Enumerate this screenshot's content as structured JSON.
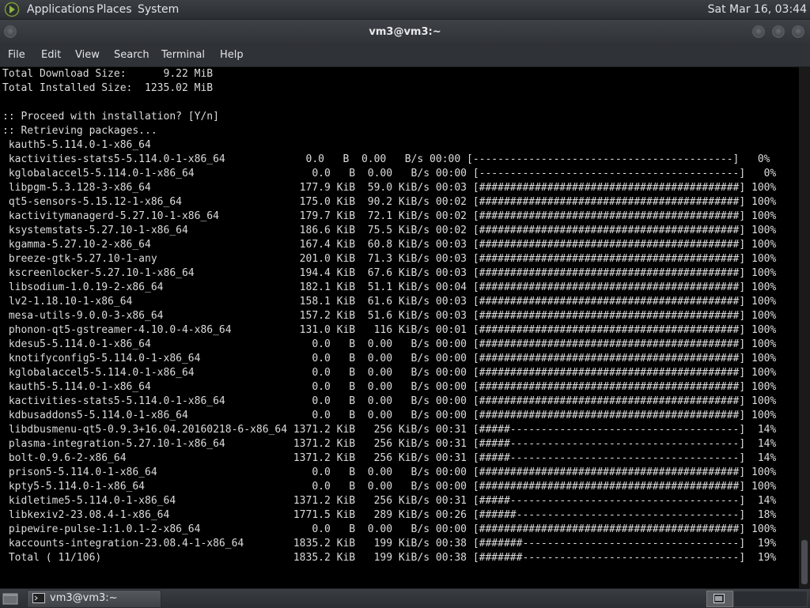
{
  "top_panel": {
    "menus": [
      "Applications",
      "Places",
      "System"
    ],
    "clock": "Sat Mar 16, 03:44"
  },
  "window": {
    "title": "vm3@vm3:~",
    "menu": [
      "File",
      "Edit",
      "View",
      "Search",
      "Terminal",
      "Help"
    ]
  },
  "terminal": {
    "lines": [
      "Total Download Size:      9.22 MiB",
      "Total Installed Size:  1235.02 MiB",
      "",
      ":: Proceed with installation? [Y/n]",
      ":: Retrieving packages...",
      " kauth5-5.114.0-1-x86_64",
      " kactivities-stats5-5.114.0-1-x86_64             0.0   B  0.00   B/s 00:00 [------------------------------------------]   0%",
      " kglobalaccel5-5.114.0-1-x86_64                   0.0   B  0.00   B/s 00:00 [------------------------------------------]   0%",
      " libpgm-5.3.128-3-x86_64                        177.9 KiB  59.0 KiB/s 00:03 [##########################################] 100%",
      " qt5-sensors-5.15.12-1-x86_64                   175.0 KiB  90.2 KiB/s 00:02 [##########################################] 100%",
      " kactivitymanagerd-5.27.10-1-x86_64             179.7 KiB  72.1 KiB/s 00:02 [##########################################] 100%",
      " ksystemstats-5.27.10-1-x86_64                  186.6 KiB  75.5 KiB/s 00:02 [##########################################] 100%",
      " kgamma-5.27.10-2-x86_64                        167.4 KiB  60.8 KiB/s 00:03 [##########################################] 100%",
      " breeze-gtk-5.27.10-1-any                       201.0 KiB  71.3 KiB/s 00:03 [##########################################] 100%",
      " kscreenlocker-5.27.10-1-x86_64                 194.4 KiB  67.6 KiB/s 00:03 [##########################################] 100%",
      " libsodium-1.0.19-2-x86_64                      182.1 KiB  51.1 KiB/s 00:04 [##########################################] 100%",
      " lv2-1.18.10-1-x86_64                           158.1 KiB  61.6 KiB/s 00:03 [##########################################] 100%",
      " mesa-utils-9.0.0-3-x86_64                      157.2 KiB  51.6 KiB/s 00:03 [##########################################] 100%",
      " phonon-qt5-gstreamer-4.10.0-4-x86_64           131.0 KiB   116 KiB/s 00:01 [##########################################] 100%",
      " kdesu5-5.114.0-1-x86_64                          0.0   B  0.00   B/s 00:00 [##########################################] 100%",
      " knotifyconfig5-5.114.0-1-x86_64                  0.0   B  0.00   B/s 00:00 [##########################################] 100%",
      " kglobalaccel5-5.114.0-1-x86_64                   0.0   B  0.00   B/s 00:00 [##########################################] 100%",
      " kauth5-5.114.0-1-x86_64                          0.0   B  0.00   B/s 00:00 [##########################################] 100%",
      " kactivities-stats5-5.114.0-1-x86_64              0.0   B  0.00   B/s 00:00 [##########################################] 100%",
      " kdbusaddons5-5.114.0-1-x86_64                    0.0   B  0.00   B/s 00:00 [##########################################] 100%",
      " libdbusmenu-qt5-0.9.3+16.04.20160218-6-x86_64 1371.2 KiB   256 KiB/s 00:31 [#####-------------------------------------]  14%",
      " plasma-integration-5.27.10-1-x86_64           1371.2 KiB   256 KiB/s 00:31 [#####-------------------------------------]  14%",
      " bolt-0.9.6-2-x86_64                           1371.2 KiB   256 KiB/s 00:31 [#####-------------------------------------]  14%",
      " prison5-5.114.0-1-x86_64                         0.0   B  0.00   B/s 00:00 [##########################################] 100%",
      " kpty5-5.114.0-1-x86_64                           0.0   B  0.00   B/s 00:00 [##########################################] 100%",
      " kidletime5-5.114.0-1-x86_64                   1371.2 KiB   256 KiB/s 00:31 [#####-------------------------------------]  14%",
      " libkexiv2-23.08.4-1-x86_64                    1771.5 KiB   289 KiB/s 00:26 [######------------------------------------]  18%",
      " pipewire-pulse-1:1.0.1-2-x86_64                  0.0   B  0.00   B/s 00:00 [##########################################] 100%",
      " kaccounts-integration-23.08.4-1-x86_64        1835.2 KiB   199 KiB/s 00:38 [#######-----------------------------------]  19%",
      " Total ( 11/106)                               1835.2 KiB   199 KiB/s 00:38 [#######-----------------------------------]  19%"
    ]
  },
  "taskbar": {
    "task_label": "vm3@vm3:~"
  },
  "icons": {
    "logo": "distro-logo-icon",
    "task": "terminal-icon",
    "workspace": "workspace-icon",
    "desktop": "show-desktop-icon"
  },
  "colors": {
    "terminal_bg": "#000000",
    "terminal_fg": "#dcdcdc",
    "panel_bg": "#2f3236"
  }
}
